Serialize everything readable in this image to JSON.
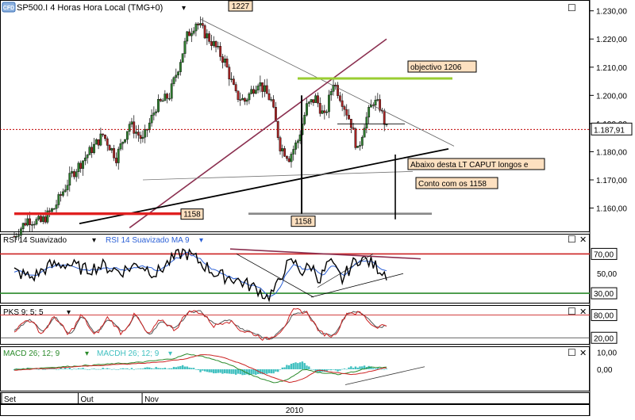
{
  "header": {
    "symbol_badge": "CFD",
    "title": "SP500.I 4 Horas Hora Local (TMG+0)",
    "dropdown_glyph": "▾",
    "maximize_glyph": "☐",
    "close_glyph": "✕"
  },
  "colors": {
    "candle_up": "#2f7d2f",
    "candle_down": "#a82424",
    "price_line": "#c00000",
    "target_line": "#9acd32",
    "rising_trend": "#8b3050",
    "annotation_fill": "#fde0c0",
    "rsi_line": "#000000",
    "rsi_ma": "#2a5fd6",
    "upper_level": "#cc2222",
    "lower_level": "#2a8a2a",
    "macd_line": "#2a8a2a",
    "macd_signal": "#cc2222",
    "macd_hist": "#40c0c0",
    "pks_fast": "#cc2222",
    "pks_slow": "#555555"
  },
  "chart_data": [
    {
      "type": "candlestick",
      "panel": "price",
      "y_ticks": [
        "1.230,00",
        "1.220,00",
        "1.210,00",
        "1.200,00",
        "1.190,00",
        "1.180,00",
        "1.170,00",
        "1.160,00"
      ],
      "y_tick_values": [
        1230,
        1220,
        1210,
        1200,
        1190,
        1180,
        1170,
        1160
      ],
      "ylim": [
        1152,
        1233
      ],
      "current_price": 1187.91,
      "current_price_label": "1.187,91",
      "swing_high": 1227,
      "swing_high_label": "1227",
      "swing_low": 1158,
      "swing_low_label": "1158",
      "support_label": "1158",
      "support_level": 1158,
      "target_level": 1206,
      "path": [
        [
          0,
          1150
        ],
        [
          6,
          1156
        ],
        [
          12,
          1155
        ],
        [
          18,
          1160
        ],
        [
          26,
          1172
        ],
        [
          34,
          1180
        ],
        [
          40,
          1186
        ],
        [
          46,
          1178
        ],
        [
          52,
          1190
        ],
        [
          58,
          1184
        ],
        [
          64,
          1196
        ],
        [
          70,
          1200
        ],
        [
          74,
          1210
        ],
        [
          78,
          1221
        ],
        [
          82,
          1226
        ],
        [
          86,
          1222
        ],
        [
          90,
          1218
        ],
        [
          95,
          1212
        ],
        [
          100,
          1200
        ],
        [
          104,
          1198
        ],
        [
          110,
          1205
        ],
        [
          116,
          1198
        ],
        [
          120,
          1182
        ],
        [
          124,
          1178
        ],
        [
          128,
          1184
        ],
        [
          132,
          1196
        ],
        [
          136,
          1199
        ],
        [
          140,
          1192
        ],
        [
          144,
          1205
        ],
        [
          148,
          1198
        ],
        [
          152,
          1190
        ],
        [
          155,
          1180
        ],
        [
          158,
          1190
        ],
        [
          162,
          1198
        ],
        [
          165,
          1196
        ],
        [
          168,
          1188
        ]
      ],
      "annotations": [
        {
          "text": "objectivo 1206"
        },
        {
          "text": "Abaixo desta LT CAPUT longos e"
        },
        {
          "text": "Conto com os 1158"
        }
      ]
    },
    {
      "type": "line",
      "panel": "rsi",
      "legend": [
        {
          "name": "RSI 14 Suavizado",
          "color": "#000000"
        },
        {
          "name": "RSI 14 Suavizado MA 9",
          "color": "#2a5fd6"
        }
      ],
      "y_ticks": [
        "70,00",
        "50,00",
        "30,00"
      ],
      "levels": [
        70,
        30
      ],
      "ylim": [
        22,
        80
      ],
      "path": [
        [
          0,
          52
        ],
        [
          8,
          46
        ],
        [
          16,
          58
        ],
        [
          24,
          60
        ],
        [
          32,
          54
        ],
        [
          40,
          58
        ],
        [
          48,
          52
        ],
        [
          56,
          60
        ],
        [
          64,
          50
        ],
        [
          70,
          62
        ],
        [
          76,
          72
        ],
        [
          80,
          68
        ],
        [
          86,
          58
        ],
        [
          92,
          48
        ],
        [
          98,
          46
        ],
        [
          104,
          40
        ],
        [
          110,
          34
        ],
        [
          114,
          26
        ],
        [
          118,
          34
        ],
        [
          122,
          56
        ],
        [
          126,
          62
        ],
        [
          130,
          52
        ],
        [
          134,
          58
        ],
        [
          138,
          44
        ],
        [
          142,
          62
        ],
        [
          148,
          44
        ],
        [
          152,
          58
        ],
        [
          156,
          66
        ],
        [
          160,
          62
        ],
        [
          164,
          56
        ],
        [
          168,
          50
        ]
      ]
    },
    {
      "type": "line",
      "panel": "pks",
      "legend": [
        {
          "name": "PKS 9; 5; 5",
          "color": "#555555"
        }
      ],
      "y_ticks": [
        "80,00",
        "20,00"
      ],
      "levels": [
        80,
        20
      ],
      "ylim": [
        8,
        100
      ],
      "path": [
        [
          0,
          40
        ],
        [
          6,
          72
        ],
        [
          12,
          30
        ],
        [
          18,
          78
        ],
        [
          24,
          24
        ],
        [
          30,
          82
        ],
        [
          36,
          22
        ],
        [
          42,
          76
        ],
        [
          48,
          30
        ],
        [
          54,
          84
        ],
        [
          60,
          24
        ],
        [
          66,
          70
        ],
        [
          72,
          40
        ],
        [
          78,
          90
        ],
        [
          84,
          88
        ],
        [
          90,
          50
        ],
        [
          96,
          70
        ],
        [
          102,
          40
        ],
        [
          108,
          30
        ],
        [
          114,
          14
        ],
        [
          120,
          42
        ],
        [
          126,
          92
        ],
        [
          132,
          86
        ],
        [
          138,
          30
        ],
        [
          144,
          26
        ],
        [
          150,
          90
        ],
        [
          156,
          84
        ],
        [
          162,
          50
        ],
        [
          168,
          54
        ]
      ]
    },
    {
      "type": "line",
      "panel": "macd",
      "legend": [
        {
          "name": "MACD 26; 12; 9",
          "color": "#2a8a2a"
        },
        {
          "name": "MACDH 26; 12; 9",
          "color": "#40c0c0"
        }
      ],
      "y_ticks": [
        "10,00",
        "0,00"
      ],
      "ylim": [
        -12,
        12
      ],
      "path": [
        [
          0,
          0
        ],
        [
          14,
          1
        ],
        [
          28,
          2
        ],
        [
          42,
          3
        ],
        [
          56,
          4
        ],
        [
          70,
          6
        ],
        [
          78,
          9
        ],
        [
          86,
          7
        ],
        [
          96,
          3
        ],
        [
          104,
          -2
        ],
        [
          112,
          -6
        ],
        [
          118,
          -8
        ],
        [
          124,
          -5
        ],
        [
          130,
          0
        ],
        [
          138,
          -2
        ],
        [
          146,
          -3
        ],
        [
          154,
          -1
        ],
        [
          160,
          1
        ],
        [
          168,
          1
        ]
      ]
    }
  ],
  "x_axis": {
    "labels": [
      {
        "text": "Set",
        "pos": 0.0
      },
      {
        "text": "Out",
        "pos": 0.17
      },
      {
        "text": "Nov",
        "pos": 0.34
      }
    ],
    "year_label": "2010"
  }
}
